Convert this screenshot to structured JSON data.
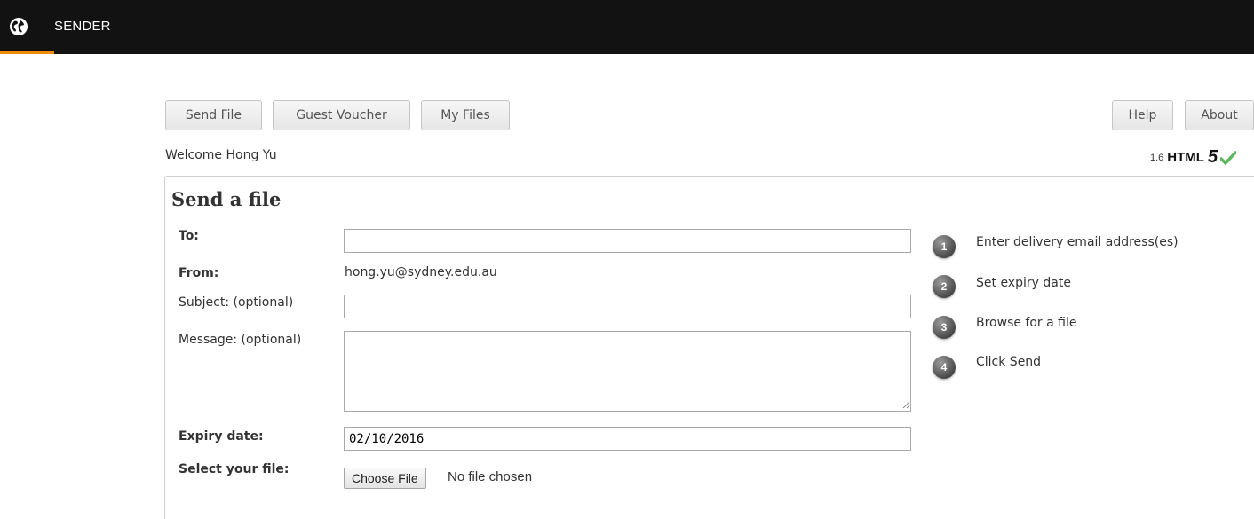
{
  "app": {
    "title": "SENDER",
    "accent_color": "#f08a00",
    "globe_icon": "globe-icon"
  },
  "nav": {
    "send_file": "Send File",
    "guest_voucher": "Guest Voucher",
    "my_files": "My Files",
    "help": "Help",
    "about": "About"
  },
  "welcome": "Welcome Hong Yu",
  "version": {
    "number": "1.6",
    "html": "HTML",
    "five": "5",
    "check_icon": "check-icon",
    "check_color": "#5cb85c"
  },
  "form": {
    "title": "Send a file",
    "to_label": "To:",
    "to_value": "",
    "from_label": "From:",
    "from_value": "hong.yu@sydney.edu.au",
    "subject_label": "Subject: (optional)",
    "subject_value": "",
    "message_label": "Message: (optional)",
    "message_value": "",
    "expiry_label": "Expiry date:",
    "expiry_value": "02/10/2016",
    "file_label": "Select your file:",
    "choose_file": "Choose File",
    "no_file": "No file chosen"
  },
  "steps": [
    {
      "num": "1",
      "text": "Enter delivery email address(es)"
    },
    {
      "num": "2",
      "text": "Set expiry date"
    },
    {
      "num": "3",
      "text": "Browse for a file"
    },
    {
      "num": "4",
      "text": "Click Send"
    }
  ]
}
